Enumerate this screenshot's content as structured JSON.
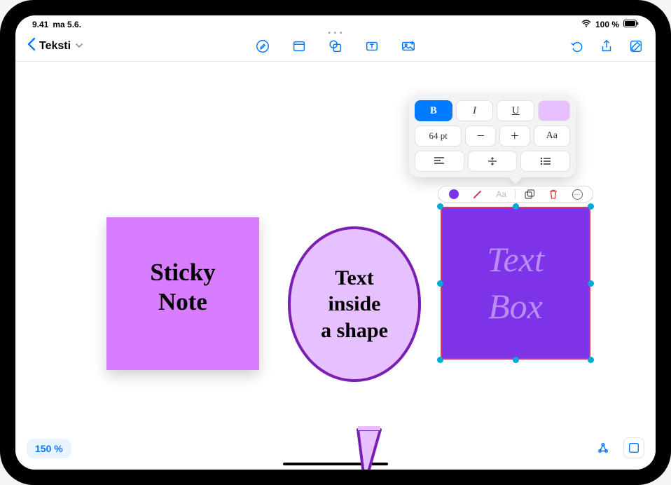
{
  "status": {
    "time": "9.41",
    "date": "ma 5.6.",
    "battery": "100 %"
  },
  "header": {
    "title": "Teksti"
  },
  "format_popover": {
    "bold": "B",
    "italic": "I",
    "underline": "U",
    "font_size": "64 pt",
    "minus": "−",
    "plus": "+",
    "text_style": "Aa"
  },
  "context_bar": {
    "aa": "Aa",
    "more": "⋯"
  },
  "canvas": {
    "sticky_note_text": "Sticky\nNote",
    "bubble_text": "Text\ninside\na shape",
    "text_box_text": "Text\nBox"
  },
  "zoom": {
    "label": "150 %"
  }
}
